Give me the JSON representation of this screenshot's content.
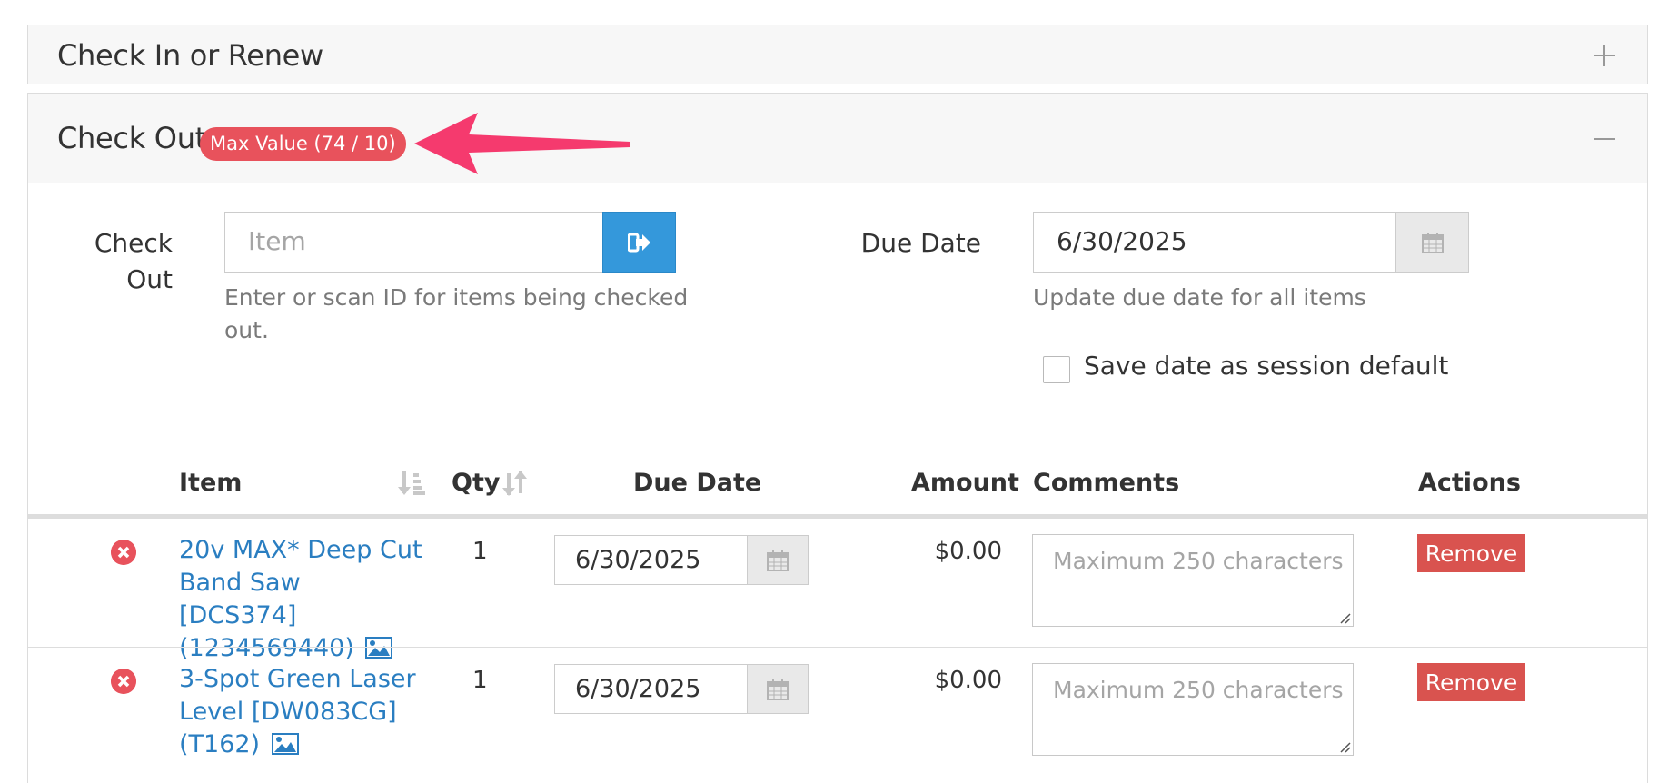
{
  "checkin_panel": {
    "title": "Check In or Renew",
    "toggle_icon": "plus-icon"
  },
  "checkout_panel": {
    "title": "Check Out",
    "badge": "Max Value (74 / 10)",
    "toggle_icon": "minus-icon",
    "annotation": "arrow-icon",
    "annotation_color": "#f53a6e"
  },
  "checkout_form": {
    "label_line1": "Check",
    "label_line2": "Out",
    "item_placeholder": "Item",
    "item_help_line1": "Enter or scan ID for items being checked",
    "item_help_line2": "out.",
    "due_label": "Due Date",
    "due_value": "6/30/2025",
    "due_help": "Update due date for all items",
    "save_default_label": "Save date as session default",
    "save_default_checked": false
  },
  "table": {
    "columns": [
      "Item",
      "Qty",
      "Due Date",
      "Amount",
      "Comments",
      "Actions"
    ],
    "rows": [
      {
        "item_line1": "20v MAX* Deep Cut",
        "item_line2": "Band Saw [DCS374]",
        "item_line3": "(1234569440)",
        "qty": "1",
        "due": "6/30/2025",
        "amount": "$0.00",
        "comment_placeholder": "Maximum 250 characters",
        "action": "Remove"
      },
      {
        "item_line1": "3-Spot Green Laser",
        "item_line2": "Level [DW083CG]",
        "item_line3": "(T162)",
        "qty": "1",
        "due": "6/30/2025",
        "amount": "$0.00",
        "comment_placeholder": "Maximum 250 characters",
        "action": "Remove"
      }
    ]
  },
  "colors": {
    "accent": "#3498db",
    "link": "#2a7ec1",
    "danger": "#d9534f",
    "badge": "#e8525c"
  }
}
